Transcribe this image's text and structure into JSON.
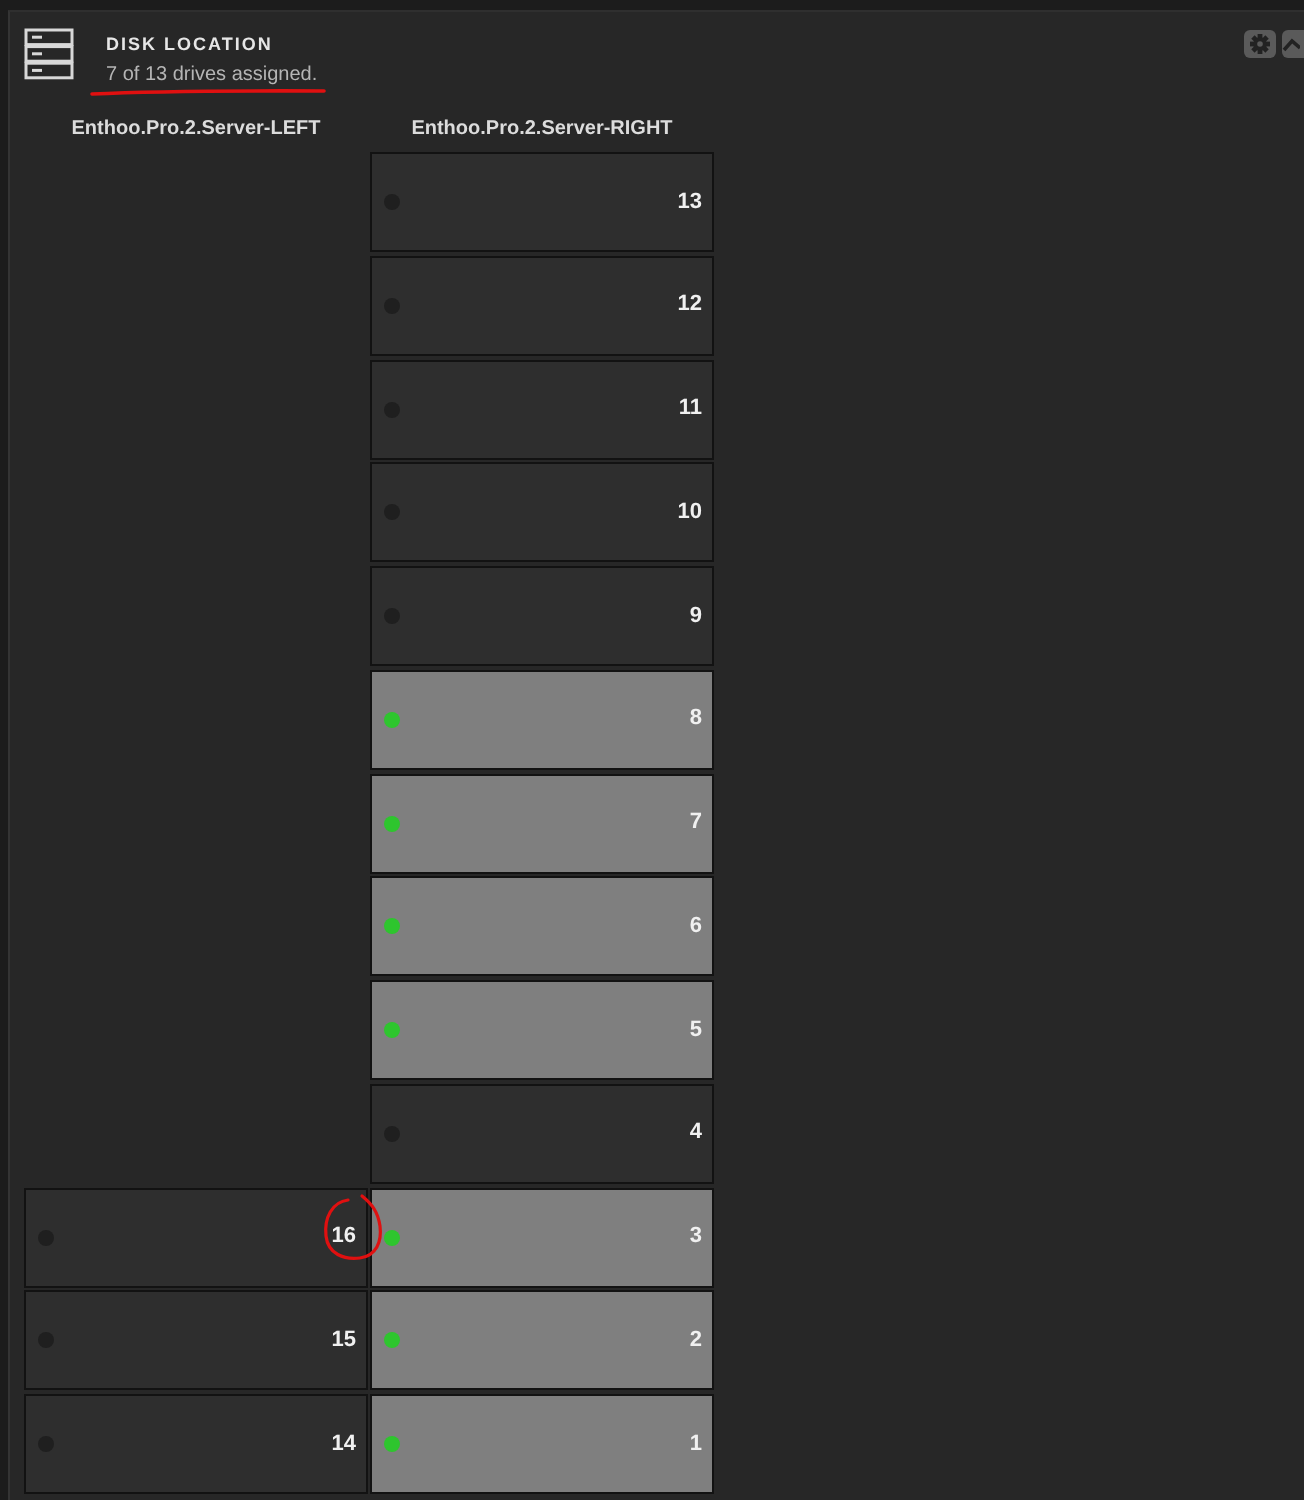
{
  "panel": {
    "title": "DISK LOCATION",
    "subtitle": {
      "text": "7 of 13 drives assigned.",
      "underlined": true
    }
  },
  "columns": [
    {
      "label": "Enthoo.Pro.2.Server-LEFT",
      "bays": [
        {
          "number": "16",
          "assigned": false,
          "circled": true
        },
        {
          "number": "15",
          "assigned": false,
          "circled": false
        },
        {
          "number": "14",
          "assigned": false,
          "circled": false
        }
      ]
    },
    {
      "label": "Enthoo.Pro.2.Server-RIGHT",
      "bays": [
        {
          "number": "13",
          "assigned": false,
          "circled": false
        },
        {
          "number": "12",
          "assigned": false,
          "circled": false
        },
        {
          "number": "11",
          "assigned": false,
          "circled": false
        },
        {
          "number": "10",
          "assigned": false,
          "circled": false
        },
        {
          "number": "9",
          "assigned": false,
          "circled": false
        },
        {
          "number": "8",
          "assigned": true,
          "circled": false
        },
        {
          "number": "7",
          "assigned": true,
          "circled": false
        },
        {
          "number": "6",
          "assigned": true,
          "circled": false
        },
        {
          "number": "5",
          "assigned": true,
          "circled": false
        },
        {
          "number": "4",
          "assigned": false,
          "circled": false
        },
        {
          "number": "3",
          "assigned": true,
          "circled": false
        },
        {
          "number": "2",
          "assigned": true,
          "circled": false
        },
        {
          "number": "1",
          "assigned": true,
          "circled": false
        }
      ]
    }
  ]
}
